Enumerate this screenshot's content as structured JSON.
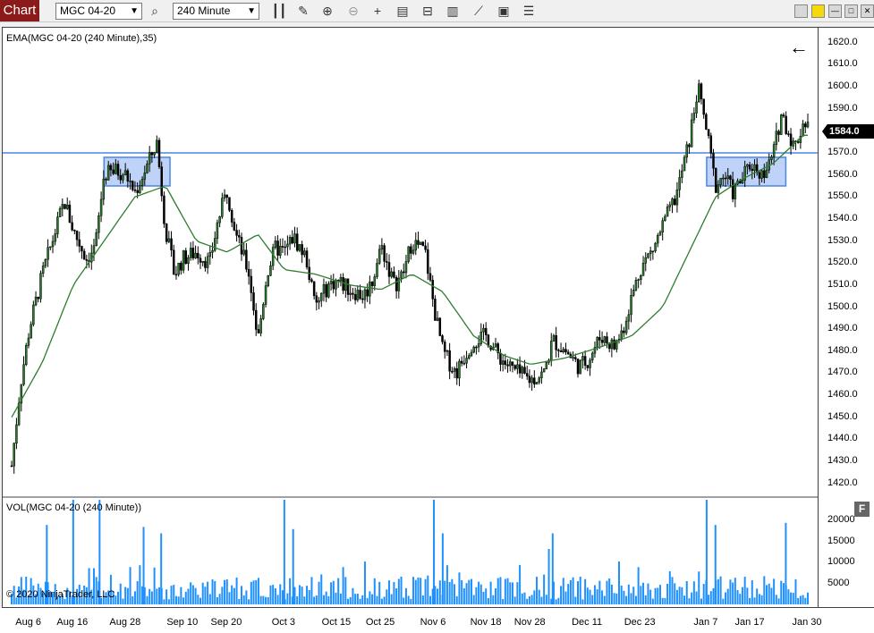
{
  "toolbar": {
    "tab_label": "Chart",
    "instrument": "MGC 04-20",
    "interval": "240 Minute",
    "icons": [
      "search-icon",
      "bar-style-icon",
      "draw-pencil-icon",
      "zoom-in-icon",
      "zoom-out-icon",
      "crosshair-icon",
      "data-box-icon",
      "chart-trader-icon",
      "indicators-icon",
      "strategies-icon",
      "properties-icon",
      "list-icon"
    ],
    "window_icons": [
      "minimize-to-group-icon",
      "highlight-icon",
      "minimize-icon",
      "maximize-icon",
      "close-icon"
    ]
  },
  "indicators": {
    "ema_label": "EMA(MGC 04-20 (240 Minute),35)",
    "vol_label": "VOL(MGC 04-20 (240 Minute))",
    "copyright": "© 2020 NinjaTrader, LLC",
    "f_button": "F"
  },
  "price_badge": "1584.0",
  "back_arrow": "←",
  "colors": {
    "candle_up": "#2a7a2a",
    "candle_down": "#000000",
    "ema_line": "#2f7d2f",
    "volume_bar": "#1e90ff",
    "horizontal_line": "#4a86e8",
    "zone_fill": "#a9c4f5",
    "zone_stroke": "#4a86e8",
    "tab_bg": "#8b1a1a"
  },
  "chart_data": {
    "type": "candlestick",
    "price_axis": {
      "ticks": [
        "1620.0",
        "1610.0",
        "1600.0",
        "1590.0",
        "1580.0",
        "1570.0",
        "1560.0",
        "1550.0",
        "1540.0",
        "1530.0",
        "1520.0",
        "1510.0",
        "1500.0",
        "1490.0",
        "1480.0",
        "1470.0",
        "1460.0",
        "1450.0",
        "1440.0",
        "1430.0",
        "1420.0"
      ],
      "range": [
        1415,
        1626
      ]
    },
    "volume_axis": {
      "ticks": [
        "20000",
        "15000",
        "10000",
        "5000"
      ],
      "range": [
        0,
        25000
      ]
    },
    "time_axis": {
      "ticks": [
        "Aug 6",
        "Aug 16",
        "Aug 28",
        "Sep 10",
        "Sep 20",
        "Oct 3",
        "Oct 15",
        "Oct 25",
        "Nov 6",
        "Nov 18",
        "Nov 28",
        "Dec 11",
        "Dec 23",
        "Jan 7",
        "Jan 17",
        "Jan 30"
      ]
    },
    "last_price": 1584.0,
    "horizontal_line": 1570,
    "zones": [
      {
        "from": "Aug 23",
        "to": "Sep 7",
        "low": 1555,
        "high": 1568
      },
      {
        "from": "Jan 7",
        "to": "Jan 25",
        "low": 1555,
        "high": 1568
      }
    ],
    "close_path": [
      [
        "Aug 2",
        1428
      ],
      [
        "Aug 4",
        1465
      ],
      [
        "Aug 6",
        1490
      ],
      [
        "Aug 9",
        1515
      ],
      [
        "Aug 12",
        1535
      ],
      [
        "Aug 14",
        1548
      ],
      [
        "Aug 16",
        1535
      ],
      [
        "Aug 19",
        1522
      ],
      [
        "Aug 21",
        1527
      ],
      [
        "Aug 23",
        1560
      ],
      [
        "Aug 26",
        1562
      ],
      [
        "Aug 28",
        1560
      ],
      [
        "Aug 30",
        1552
      ],
      [
        "Sep 2",
        1565
      ],
      [
        "Sep 4",
        1575
      ],
      [
        "Sep 6",
        1535
      ],
      [
        "Sep 8",
        1515
      ],
      [
        "Sep 10",
        1522
      ],
      [
        "Sep 13",
        1525
      ],
      [
        "Sep 16",
        1520
      ],
      [
        "Sep 18",
        1540
      ],
      [
        "Sep 20",
        1553
      ],
      [
        "Sep 22",
        1533
      ],
      [
        "Sep 25",
        1515
      ],
      [
        "Sep 27",
        1485
      ],
      [
        "Sep 29",
        1515
      ],
      [
        "Oct 1",
        1527
      ],
      [
        "Oct 3",
        1525
      ],
      [
        "Oct 5",
        1532
      ],
      [
        "Oct 8",
        1522
      ],
      [
        "Oct 10",
        1500
      ],
      [
        "Oct 13",
        1510
      ],
      [
        "Oct 15",
        1512
      ],
      [
        "Oct 18",
        1508
      ],
      [
        "Oct 21",
        1505
      ],
      [
        "Oct 23",
        1512
      ],
      [
        "Oct 25",
        1528
      ],
      [
        "Oct 28",
        1510
      ],
      [
        "Oct 30",
        1515
      ],
      [
        "Nov 1",
        1530
      ],
      [
        "Nov 4",
        1525
      ],
      [
        "Nov 6",
        1500
      ],
      [
        "Nov 8",
        1480
      ],
      [
        "Nov 11",
        1470
      ],
      [
        "Nov 13",
        1478
      ],
      [
        "Nov 15",
        1485
      ],
      [
        "Nov 18",
        1487
      ],
      [
        "Nov 20",
        1480
      ],
      [
        "Nov 22",
        1475
      ],
      [
        "Nov 25",
        1470
      ],
      [
        "Nov 28",
        1467
      ],
      [
        "Dec 1",
        1470
      ],
      [
        "Dec 3",
        1485
      ],
      [
        "Dec 6",
        1480
      ],
      [
        "Dec 9",
        1473
      ],
      [
        "Dec 11",
        1476
      ],
      [
        "Dec 14",
        1487
      ],
      [
        "Dec 17",
        1482
      ],
      [
        "Dec 19",
        1490
      ],
      [
        "Dec 21",
        1505
      ],
      [
        "Dec 23",
        1518
      ],
      [
        "Dec 26",
        1527
      ],
      [
        "Dec 28",
        1537
      ],
      [
        "Dec 31",
        1550
      ],
      [
        "Jan 3",
        1575
      ],
      [
        "Jan 5",
        1600
      ],
      [
        "Jan 7",
        1580
      ],
      [
        "Jan 9",
        1555
      ],
      [
        "Jan 11",
        1560
      ],
      [
        "Jan 13",
        1552
      ],
      [
        "Jan 15",
        1558
      ],
      [
        "Jan 17",
        1565
      ],
      [
        "Jan 20",
        1560
      ],
      [
        "Jan 22",
        1568
      ],
      [
        "Jan 24",
        1588
      ],
      [
        "Jan 27",
        1572
      ],
      [
        "Jan 29",
        1584
      ]
    ],
    "ema_path": [
      [
        "Aug 2",
        1450
      ],
      [
        "Aug 9",
        1475
      ],
      [
        "Aug 16",
        1510
      ],
      [
        "Aug 23",
        1530
      ],
      [
        "Aug 30",
        1550
      ],
      [
        "Sep 6",
        1555
      ],
      [
        "Sep 13",
        1530
      ],
      [
        "Sep 20",
        1525
      ],
      [
        "Sep 27",
        1533
      ],
      [
        "Oct 3",
        1517
      ],
      [
        "Oct 10",
        1515
      ],
      [
        "Oct 18",
        1510
      ],
      [
        "Oct 25",
        1508
      ],
      [
        "Nov 1",
        1515
      ],
      [
        "Nov 8",
        1507
      ],
      [
        "Nov 15",
        1487
      ],
      [
        "Nov 22",
        1478
      ],
      [
        "Nov 28",
        1474
      ],
      [
        "Dec 6",
        1477
      ],
      [
        "Dec 14",
        1482
      ],
      [
        "Dec 21",
        1487
      ],
      [
        "Dec 28",
        1500
      ],
      [
        "Jan 3",
        1525
      ],
      [
        "Jan 9",
        1550
      ],
      [
        "Jan 15",
        1558
      ],
      [
        "Jan 22",
        1565
      ],
      [
        "Jan 29",
        1578
      ]
    ],
    "volume_spikes": [
      [
        "Aug 10",
        19000
      ],
      [
        "Aug 16",
        25000
      ],
      [
        "Aug 22",
        25000
      ],
      [
        "Sep 1",
        18500
      ],
      [
        "Sep 5",
        17000
      ],
      [
        "Oct 3",
        25000
      ],
      [
        "Oct 5",
        18000
      ],
      [
        "Nov 6",
        25000
      ],
      [
        "Nov 8",
        17000
      ],
      [
        "Dec 3",
        17000
      ],
      [
        "Jan 7",
        25000
      ],
      [
        "Jan 9",
        19000
      ],
      [
        "Jan 25",
        19500
      ]
    ]
  }
}
